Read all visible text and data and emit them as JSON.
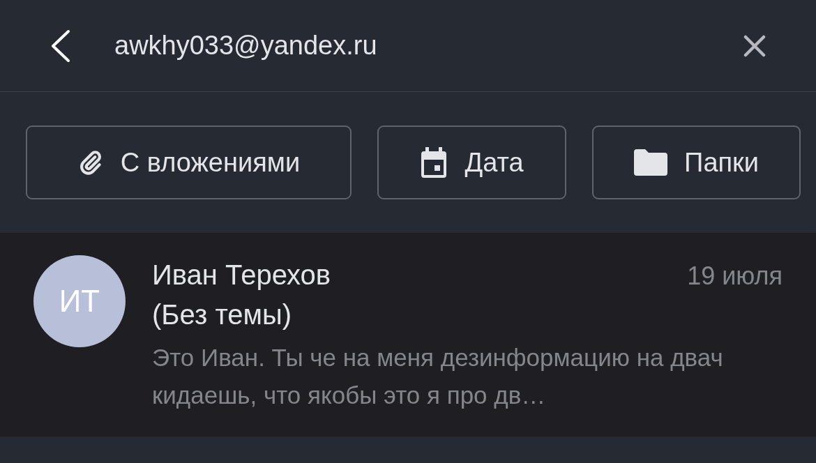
{
  "header": {
    "query": "awkhy033@yandex.ru"
  },
  "filters": [
    {
      "kind": "attachment",
      "label": "С вложениями"
    },
    {
      "kind": "calendar",
      "label": "Дата"
    },
    {
      "kind": "folder",
      "label": "Папки"
    }
  ],
  "messages": [
    {
      "initials": "ИТ",
      "sender": "Иван Терехов",
      "date": "19 июля",
      "subject": "(Без темы)",
      "preview": "Это Иван. Ты че на меня дезинформацию на двач кидаешь, что якобы это я про дв…"
    }
  ]
}
